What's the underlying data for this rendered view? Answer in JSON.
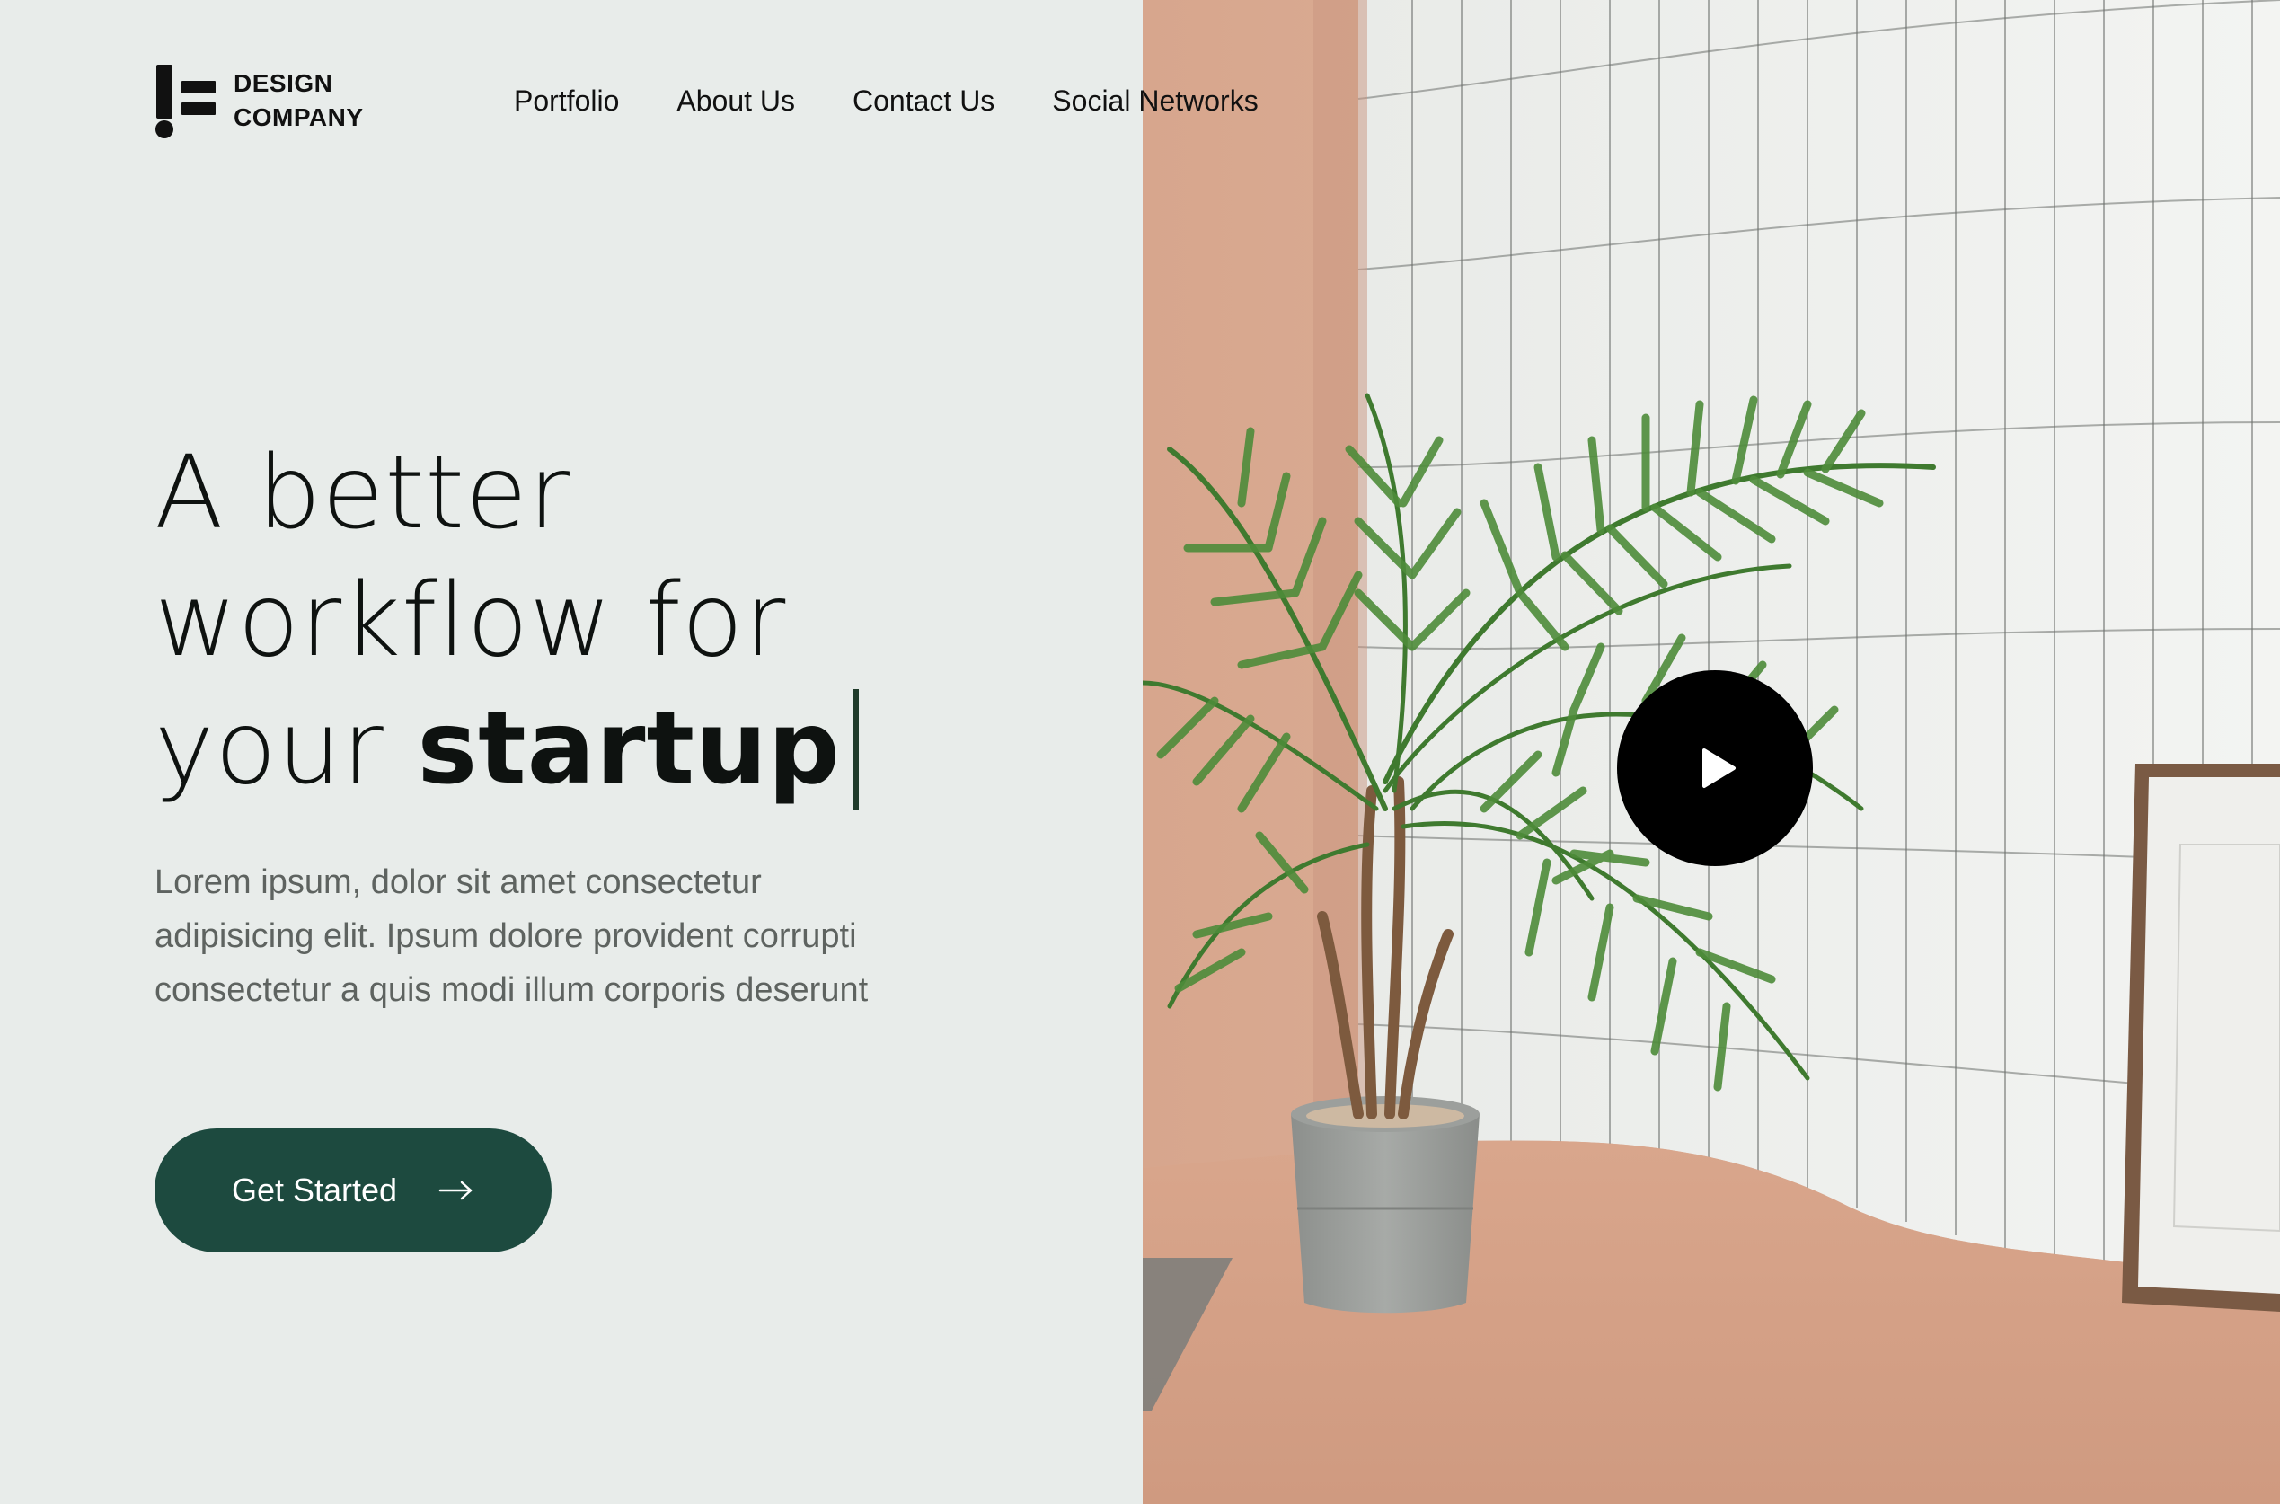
{
  "brand": {
    "line1": "DESIGN",
    "line2": "COMPANY",
    "icon": "logo-mark-icon"
  },
  "nav": {
    "items": [
      {
        "label": "Portfolio"
      },
      {
        "label": "About Us"
      },
      {
        "label": "Contact Us"
      },
      {
        "label": "Social Networks"
      }
    ]
  },
  "hero": {
    "title_line1": "A better",
    "title_line2": "workflow for",
    "title_line3_light": "your ",
    "title_line3_bold": "startup",
    "description": "Lorem ipsum, dolor sit amet consectetur adipisicing elit. Ipsum dolore provident corrupti consectetur a quis modi illum corporis deserunt",
    "cta_label": "Get Started",
    "cta_icon": "arrow-right-icon"
  },
  "media": {
    "play_icon": "play-icon"
  },
  "colors": {
    "background": "#e8ecea",
    "accent": "#1d4a3f",
    "text": "#0e1210",
    "muted": "#5e6360"
  }
}
